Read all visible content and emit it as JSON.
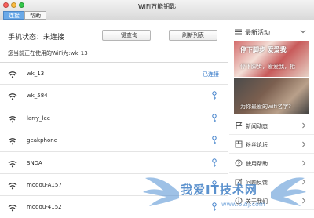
{
  "window": {
    "title": "WiFi万能钥匙",
    "tabs": [
      {
        "label": "连接",
        "active": true
      },
      {
        "label": "帮助",
        "active": false
      }
    ]
  },
  "main": {
    "status_label": "手机状态：未连接",
    "check_button": "一键查询",
    "refresh_button": "刷新列表",
    "current_wifi_text": "您当前正在使用的WiFi为:wk_13",
    "networks": [
      {
        "name": "wk_13",
        "status": "已连接",
        "icon": "wifi-icon",
        "action_icon": ""
      },
      {
        "name": "wk_584",
        "status": "",
        "icon": "wifi-icon",
        "action_icon": "key-icon"
      },
      {
        "name": "larry_lee",
        "status": "",
        "icon": "wifi-icon",
        "action_icon": "key-icon"
      },
      {
        "name": "geakphone",
        "status": "",
        "icon": "wifi-icon",
        "action_icon": "key-icon"
      },
      {
        "name": "SNDA",
        "status": "",
        "icon": "wifi-icon",
        "action_icon": "key-icon"
      },
      {
        "name": "modou-A157",
        "status": "",
        "icon": "wifi-icon",
        "action_icon": "key-icon"
      },
      {
        "name": "modou-4152",
        "status": "",
        "icon": "wifi-icon",
        "action_icon": "key-icon"
      }
    ]
  },
  "sidebar": {
    "header_label": "最新活动",
    "promos": [
      {
        "main_text": "停下脚步 爱爱我",
        "sub_text": "停下脚步，爱爱我，抢"
      },
      {
        "main_text": "为你最爱的wifi名字?",
        "sub_text": ""
      }
    ],
    "items": [
      {
        "label": "新闻动态",
        "icon": "flag-icon"
      },
      {
        "label": "粉丝论坛",
        "icon": "forum-icon"
      },
      {
        "label": "使用帮助",
        "icon": "help-icon"
      },
      {
        "label": "问题反馈",
        "icon": "feedback-icon"
      },
      {
        "label": "关于我们",
        "icon": "info-icon"
      }
    ]
  },
  "watermark": {
    "text": "我爱IT技术网",
    "url": "www.52ij.com"
  },
  "colors": {
    "accent": "#3a7cc9",
    "tab_active": "#6aa9e8"
  }
}
